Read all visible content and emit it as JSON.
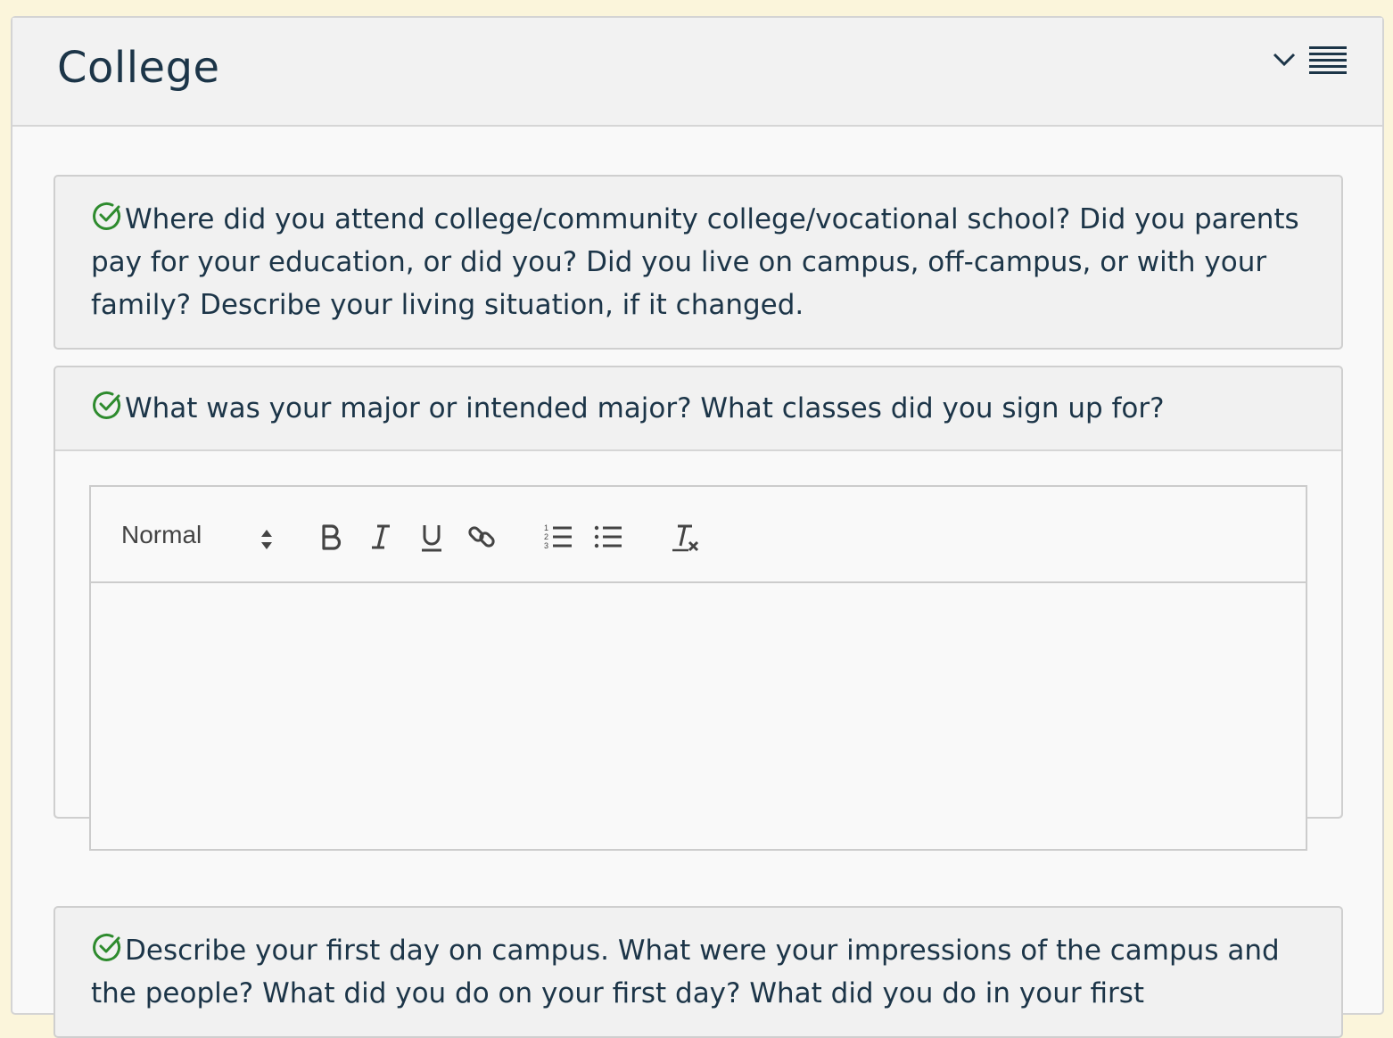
{
  "panel": {
    "title": "College"
  },
  "questions": [
    {
      "text": "Where did you attend college/community college/vocational school? Did you parents pay for your education, or did you? Did you live on campus, off-campus, or with your family? Describe your living situation, if it changed."
    },
    {
      "text": "What was your major or intended major? What classes did you sign up for?",
      "editor": {
        "format_select": "Normal",
        "content": ""
      }
    },
    {
      "text": "Describe your first day on campus. What were your impressions of the campus and the people? What did you do on your first day? What did you do in your first"
    }
  ],
  "icons": {
    "check": "check-circle-icon",
    "chevron": "chevron-down-icon",
    "menu": "hamburger-menu-icon",
    "bold": "bold-icon",
    "italic": "italic-icon",
    "underline": "underline-icon",
    "link": "link-icon",
    "ordered_list": "ordered-list-icon",
    "bullet_list": "bullet-list-icon",
    "clear_format": "clear-format-icon"
  },
  "colors": {
    "page_background": "#fbf5db",
    "text": "#1c3548",
    "check": "#2e8b2e"
  }
}
